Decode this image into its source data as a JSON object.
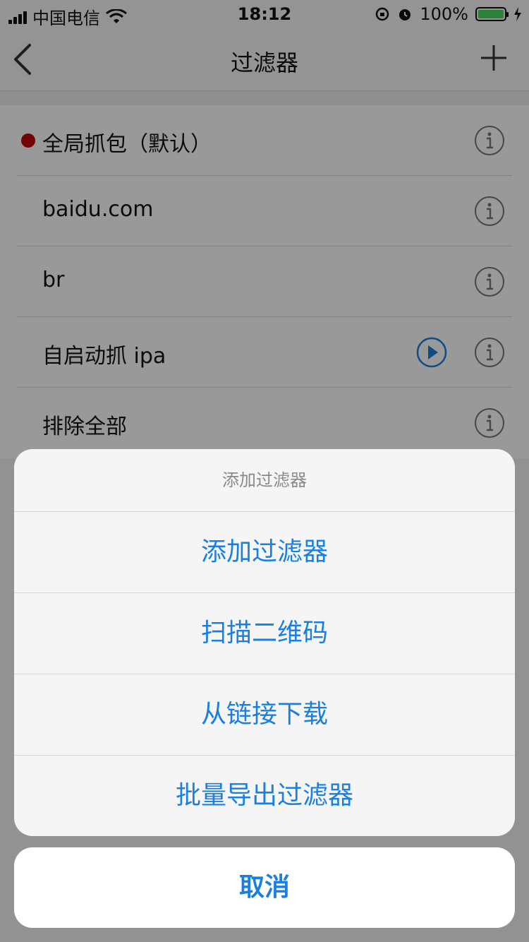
{
  "status_bar": {
    "carrier": "中国电信",
    "time": "18:12",
    "battery": "100%"
  },
  "nav": {
    "title": "过滤器",
    "back_icon": "chevron-left-icon",
    "add_icon": "plus-icon"
  },
  "filters": [
    {
      "label": "全局抓包（默认）",
      "active": true,
      "has_play": false
    },
    {
      "label": "baidu.com",
      "active": false,
      "has_play": false
    },
    {
      "label": "br",
      "active": false,
      "has_play": false
    },
    {
      "label": "自启动抓 ipa",
      "active": false,
      "has_play": true
    },
    {
      "label": "排除全部",
      "active": false,
      "has_play": false
    }
  ],
  "action_sheet": {
    "title": "添加过滤器",
    "actions": [
      "添加过滤器",
      "扫描二维码",
      "从链接下载",
      "批量导出过滤器"
    ],
    "cancel": "取消"
  },
  "colors": {
    "accent": "#1a7fe0",
    "active_dot": "#c0090b",
    "battery": "#4cd964"
  }
}
